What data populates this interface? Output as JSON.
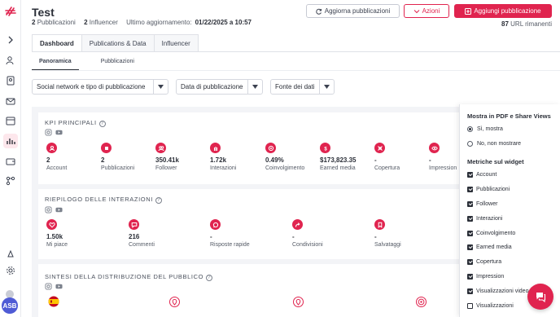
{
  "header": {
    "title": "Test",
    "publications_count": "2",
    "publications_label": "Pubblicazioni",
    "influencers_count": "2",
    "influencers_label": "Influencer",
    "updated_label": "Ultimo aggiornamento:",
    "updated_value": "01/22/2025 a 10:57",
    "urls_count": "87",
    "urls_label": "URL rimanenti"
  },
  "toolbar": {
    "refresh_label": "Aggiorna pubblicazioni",
    "actions_label": "Azioni",
    "add_label": "Aggiungi pubblicazione"
  },
  "tabs": [
    "Dashboard",
    "Publications & Data",
    "Influencer"
  ],
  "subtabs": [
    "Panoramica",
    "Pubblicazioni"
  ],
  "filters": [
    "Social network e tipo di pubblicazione",
    "Data di pubblicazione",
    "Fonte dei dati"
  ],
  "sections": {
    "kpi_title": "KPI PRINCIPALI",
    "interactions_title": "RIEPILOGO DELLE INTERAZIONI",
    "audience_title": "SINTESI DELLA DISTRIBUZIONE DEL PUBBLICO"
  },
  "kpis": [
    {
      "value": "2",
      "label": "Account",
      "icon": "user-icon"
    },
    {
      "value": "2",
      "label": "Pubblicazioni",
      "icon": "post-icon"
    },
    {
      "value": "350.41k",
      "label": "Follower",
      "icon": "followers-icon"
    },
    {
      "value": "1.72k",
      "label": "Interazioni",
      "icon": "hand-icon"
    },
    {
      "value": "0.49%",
      "label": "Coinvolgimento",
      "icon": "target-icon"
    },
    {
      "value": "$173,823.35",
      "label": "Earned media",
      "icon": "dollar-icon"
    },
    {
      "value": "-",
      "label": "Copertura",
      "icon": "reach-icon"
    },
    {
      "value": "-",
      "label": "Impression",
      "icon": "eye-icon"
    }
  ],
  "interactions": [
    {
      "value": "1.50k",
      "label": "Mi piace",
      "icon": "heart-icon"
    },
    {
      "value": "216",
      "label": "Commenti",
      "icon": "comment-icon"
    },
    {
      "value": "-",
      "label": "Risposte rapide",
      "icon": "reply-icon"
    },
    {
      "value": "-",
      "label": "Condivisioni",
      "icon": "share-icon"
    },
    {
      "value": "-",
      "label": "Salvataggi",
      "icon": "bookmark-icon"
    }
  ],
  "panel": {
    "pdf_title": "Mostra in PDF e Share Views",
    "yes_label": "Sì, mostra",
    "no_label": "No, non mostrare",
    "widgets_title": "Metriche sul widget",
    "widgets": [
      {
        "label": "Account",
        "checked": true
      },
      {
        "label": "Pubblicazioni",
        "checked": true
      },
      {
        "label": "Follower",
        "checked": true
      },
      {
        "label": "Interazioni",
        "checked": true
      },
      {
        "label": "Coinvolgimento",
        "checked": true
      },
      {
        "label": "Earned media",
        "checked": true
      },
      {
        "label": "Copertura",
        "checked": true
      },
      {
        "label": "Impression",
        "checked": true
      },
      {
        "label": "Visualizzazioni video",
        "checked": true
      },
      {
        "label": "Visualizzazioni",
        "checked": false
      }
    ]
  },
  "user": {
    "initials": "ASB"
  },
  "colors": {
    "accent": "#e0244f",
    "text": "#2b2f38",
    "muted": "#555b66"
  }
}
